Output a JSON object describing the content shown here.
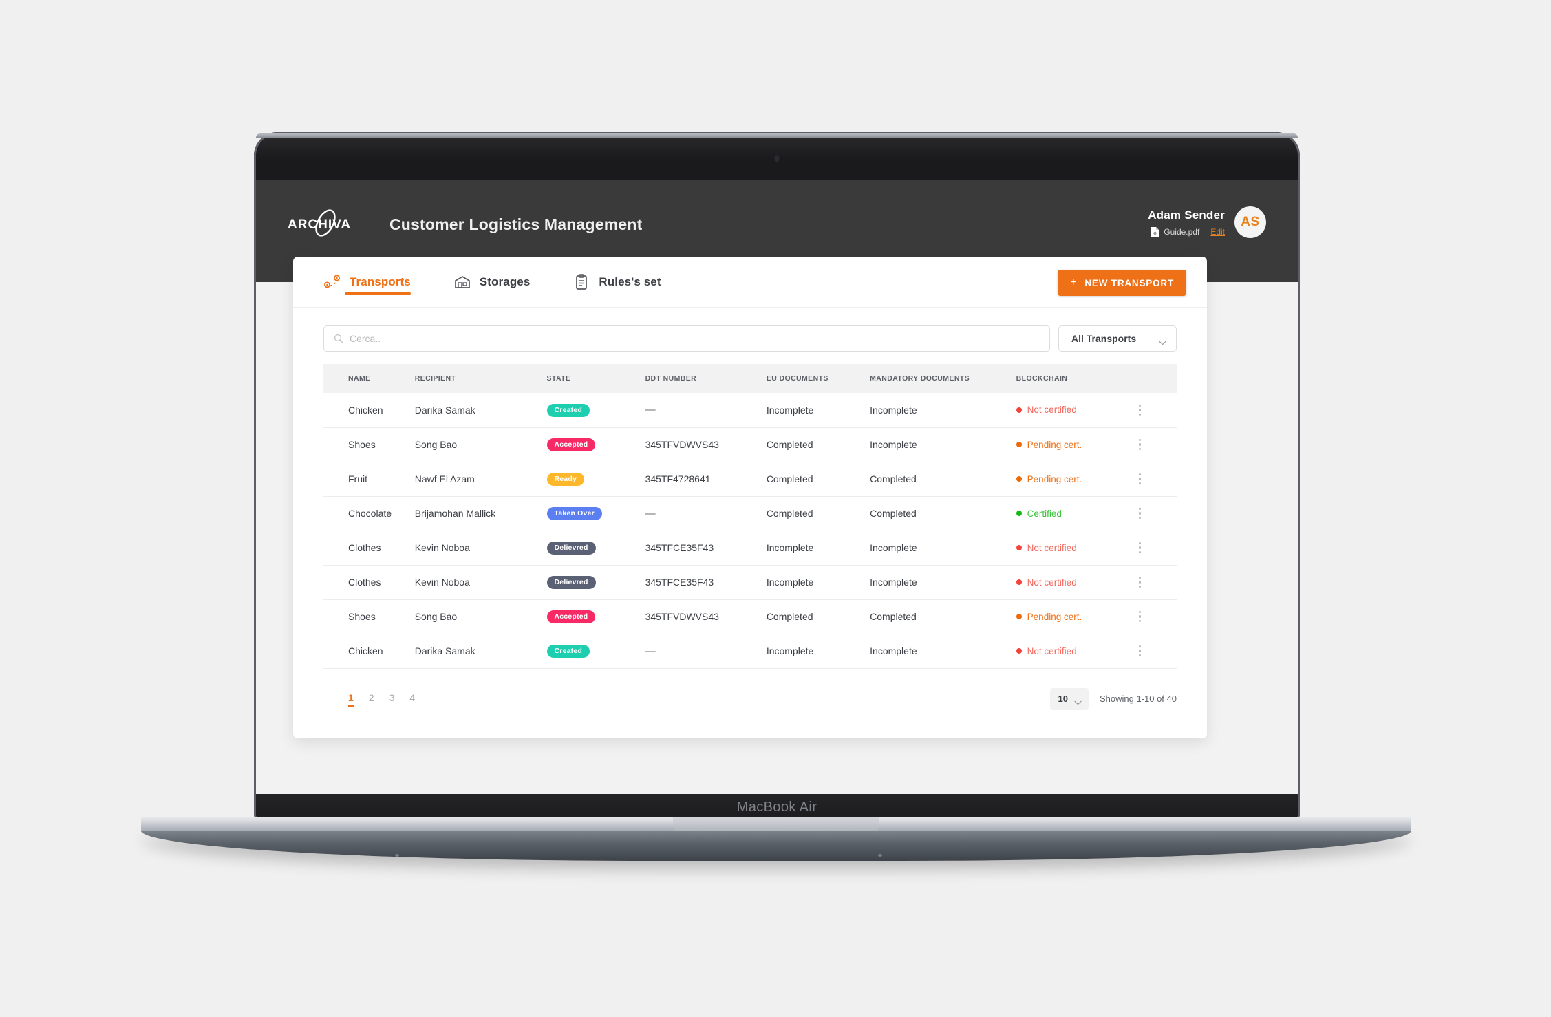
{
  "device": {
    "model_label": "MacBook Air"
  },
  "header": {
    "logo_text": "ARCHIVA",
    "app_title": "Customer Logistics Management",
    "user": {
      "name": "Adam Sender",
      "document": "Guide.pdf",
      "edit_label": "Edit",
      "avatar_initials": "AS"
    }
  },
  "tabs": [
    {
      "label": "Transports",
      "icon": "transports-route-icon",
      "active": true
    },
    {
      "label": "Storages",
      "icon": "warehouse-icon",
      "active": false
    },
    {
      "label": "Rules's set",
      "icon": "clipboard-rules-icon",
      "active": false
    }
  ],
  "actions": {
    "new_transport_label": "NEW TRANSPORT",
    "new_transport_plus": "+"
  },
  "filters": {
    "search_placeholder": "Cerca..",
    "search_value": "",
    "transport_filter_selected": "All Transports"
  },
  "table": {
    "columns": [
      "NAME",
      "RECIPIENT",
      "STATE",
      "DDT NUMBER",
      "EU DOCUMENTS",
      "MANDATORY DOCUMENTS",
      "BLOCKCHAIN"
    ],
    "rows": [
      {
        "name": "Chicken",
        "recipient": "Darika Samak",
        "state": "Created",
        "state_color": "#1ecfaf",
        "ddt": "—",
        "eu": "Incomplete",
        "mandatory": "Incomplete",
        "blockchain": "Not certified",
        "blockchain_color": "#f3685e",
        "blockchain_dot": "#f4433a"
      },
      {
        "name": "Shoes",
        "recipient": "Song Bao",
        "state": "Accepted",
        "state_color": "#f72a66",
        "ddt": "345TFVDWVS43",
        "eu": "Completed",
        "mandatory": "Incomplete",
        "blockchain": "Pending cert.",
        "blockchain_color": "#ef7117",
        "blockchain_dot": "#ed6b06"
      },
      {
        "name": "Fruit",
        "recipient": "Nawf El Azam",
        "state": "Ready",
        "state_color": "#fcb72b",
        "ddt": "345TF4728641",
        "eu": "Completed",
        "mandatory": "Completed",
        "blockchain": "Pending cert.",
        "blockchain_color": "#ef7117",
        "blockchain_dot": "#ed6b06"
      },
      {
        "name": "Chocolate",
        "recipient": "Brijamohan Mallick",
        "state": "Taken Over",
        "state_color": "#5b7ef0",
        "ddt": "—",
        "eu": "Completed",
        "mandatory": "Completed",
        "blockchain": "Certified",
        "blockchain_color": "#3dc53d",
        "blockchain_dot": "#11bb11"
      },
      {
        "name": "Clothes",
        "recipient": "Kevin Noboa",
        "state": "Delievred",
        "state_color": "#5a6175",
        "ddt": "345TFCE35F43",
        "eu": "Incomplete",
        "mandatory": "Incomplete",
        "blockchain": "Not certified",
        "blockchain_color": "#f3685e",
        "blockchain_dot": "#f4433a"
      },
      {
        "name": "Clothes",
        "recipient": "Kevin Noboa",
        "state": "Delievred",
        "state_color": "#5a6175",
        "ddt": "345TFCE35F43",
        "eu": "Incomplete",
        "mandatory": "Incomplete",
        "blockchain": "Not certified",
        "blockchain_color": "#f3685e",
        "blockchain_dot": "#f4433a"
      },
      {
        "name": "Shoes",
        "recipient": "Song Bao",
        "state": "Accepted",
        "state_color": "#f72a66",
        "ddt": "345TFVDWVS43",
        "eu": "Completed",
        "mandatory": "Completed",
        "blockchain": "Pending cert.",
        "blockchain_color": "#ef7117",
        "blockchain_dot": "#ed6b06"
      },
      {
        "name": "Chicken",
        "recipient": "Darika Samak",
        "state": "Created",
        "state_color": "#1ecfaf",
        "ddt": "—",
        "eu": "Incomplete",
        "mandatory": "Incomplete",
        "blockchain": "Not certified",
        "blockchain_color": "#f3685e",
        "blockchain_dot": "#f4433a"
      }
    ]
  },
  "pagination": {
    "pages": [
      "1",
      "2",
      "3",
      "4"
    ],
    "active_page": "1",
    "page_size": "10",
    "showing": "Showing 1-10 of 40"
  },
  "colors": {
    "accent": "#ef7117",
    "header_bg": "#3a3a3a",
    "page_bg": "#f2f2f2"
  }
}
